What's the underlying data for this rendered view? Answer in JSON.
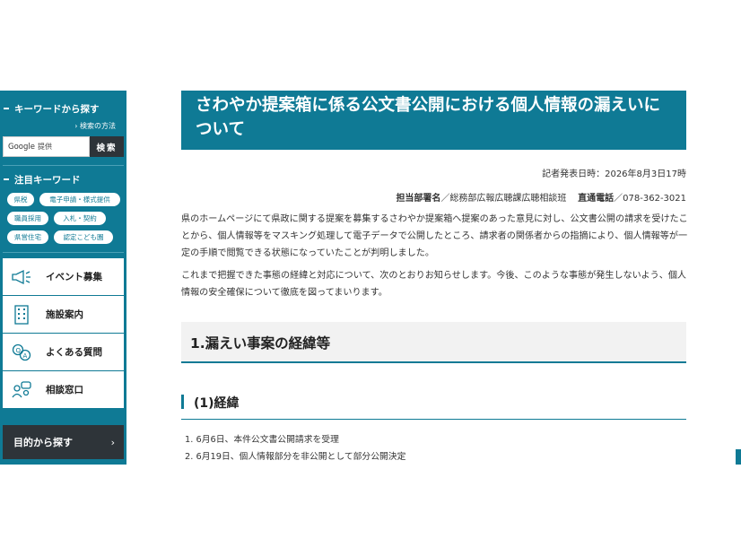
{
  "sidebar": {
    "keyword_heading": "キーワードから探す",
    "search_help": "検索の方法",
    "search_engine_label": "Google",
    "search_engine_suffix": "提供",
    "search_button": "検索",
    "featured_heading": "注目キーワード",
    "tags": [
      "県税",
      "電子申請・様式提供",
      "職員採用",
      "入札・契約",
      "県営住宅",
      "認定こども園"
    ],
    "menu": [
      {
        "label": "イベント募集",
        "icon": "megaphone-icon"
      },
      {
        "label": "施設案内",
        "icon": "building-icon"
      },
      {
        "label": "よくある質問",
        "icon": "qa-icon"
      },
      {
        "label": "相談窓口",
        "icon": "consultation-icon"
      }
    ],
    "purpose_label": "目的から探す",
    "purpose_chevron": "›"
  },
  "main": {
    "title": "さわやか提案箱に係る公文書公開における個人情報の漏えいについて",
    "date_line": "記者発表日時：2026年8月3日17時",
    "dept_label": "担当部署名",
    "dept_value": "／総務部広報広聴課広聴相談班",
    "phone_label": "直通電話",
    "phone_value": "／078-362-3021",
    "paragraph1": "県のホームページにて県政に関する提案を募集するさわやか提案箱へ提案のあった意見に対し、公文書公開の請求を受けたことから、個人情報等をマスキング処理して電子データで公開したところ、請求者の関係者からの指摘により、個人情報等が一定の手順で閲覧できる状態になっていたことが判明しました。",
    "paragraph2": "これまで把握できた事態の経緯と対応について、次のとおりお知らせします。今後、このような事態が発生しないよう、個人情報の安全確保について徹底を図ってまいります。",
    "section_heading": "1.漏えい事案の経緯等",
    "subsection_heading": "(1)経緯",
    "list": [
      "1. 6月6日、本件公文書公開請求を受理",
      "2. 6月19日、個人情報部分を非公開として部分公開決定"
    ]
  },
  "colors": {
    "brand": "#0f7a95",
    "dark": "#2e3439",
    "heading_bg": "#f2f2f2"
  }
}
